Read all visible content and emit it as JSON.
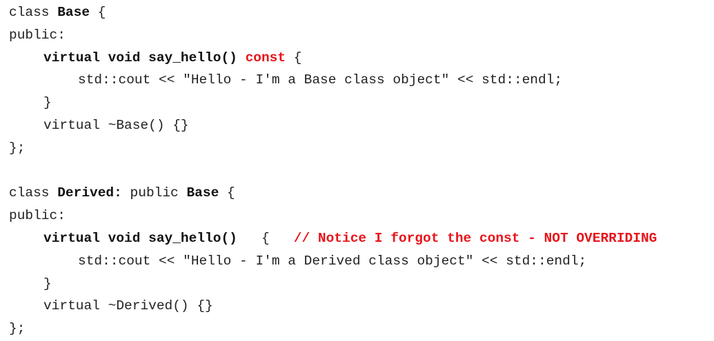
{
  "code": {
    "lines": [
      {
        "indent": 0,
        "tokens": [
          {
            "t": "class ",
            "s": "normal"
          },
          {
            "t": "Base",
            "s": "bold"
          },
          {
            "t": " {",
            "s": "normal"
          }
        ]
      },
      {
        "indent": 0,
        "tokens": [
          {
            "t": "public:",
            "s": "normal"
          }
        ]
      },
      {
        "indent": 1,
        "tokens": [
          {
            "t": "virtual void say_hello()",
            "s": "bold"
          },
          {
            "t": " ",
            "s": "normal"
          },
          {
            "t": "const",
            "s": "red"
          },
          {
            "t": " {",
            "s": "normal"
          }
        ]
      },
      {
        "indent": 2,
        "tokens": [
          {
            "t": "std::cout << \"Hello - I'm a Base class object\" << std::endl;",
            "s": "normal"
          }
        ]
      },
      {
        "indent": 1,
        "tokens": [
          {
            "t": "}",
            "s": "normal"
          }
        ]
      },
      {
        "indent": 1,
        "tokens": [
          {
            "t": "virtual ~Base() {}",
            "s": "normal"
          }
        ]
      },
      {
        "indent": 0,
        "tokens": [
          {
            "t": "};",
            "s": "normal"
          }
        ]
      },
      {
        "indent": 0,
        "tokens": []
      },
      {
        "indent": 0,
        "tokens": [
          {
            "t": "class ",
            "s": "normal"
          },
          {
            "t": "Derived:",
            "s": "bold"
          },
          {
            "t": " public ",
            "s": "normal"
          },
          {
            "t": "Base",
            "s": "bold"
          },
          {
            "t": " {",
            "s": "normal"
          }
        ]
      },
      {
        "indent": 0,
        "tokens": [
          {
            "t": "public:",
            "s": "normal"
          }
        ]
      },
      {
        "indent": 1,
        "tokens": [
          {
            "t": "virtual void say_hello()",
            "s": "bold"
          },
          {
            "t": "   {   ",
            "s": "normal"
          },
          {
            "t": "// Notice I forgot the const - NOT OVERRIDING",
            "s": "red"
          }
        ]
      },
      {
        "indent": 2,
        "tokens": [
          {
            "t": "std::cout << \"Hello - I'm a Derived class object\" << std::endl;",
            "s": "normal"
          }
        ]
      },
      {
        "indent": 1,
        "tokens": [
          {
            "t": "}",
            "s": "normal"
          }
        ]
      },
      {
        "indent": 1,
        "tokens": [
          {
            "t": "virtual ~Derived() {}",
            "s": "normal"
          }
        ]
      },
      {
        "indent": 0,
        "tokens": [
          {
            "t": "};",
            "s": "normal"
          }
        ]
      }
    ]
  },
  "colors": {
    "text": "#222222",
    "keyword_red": "#e8141b",
    "background": "#ffffff"
  }
}
